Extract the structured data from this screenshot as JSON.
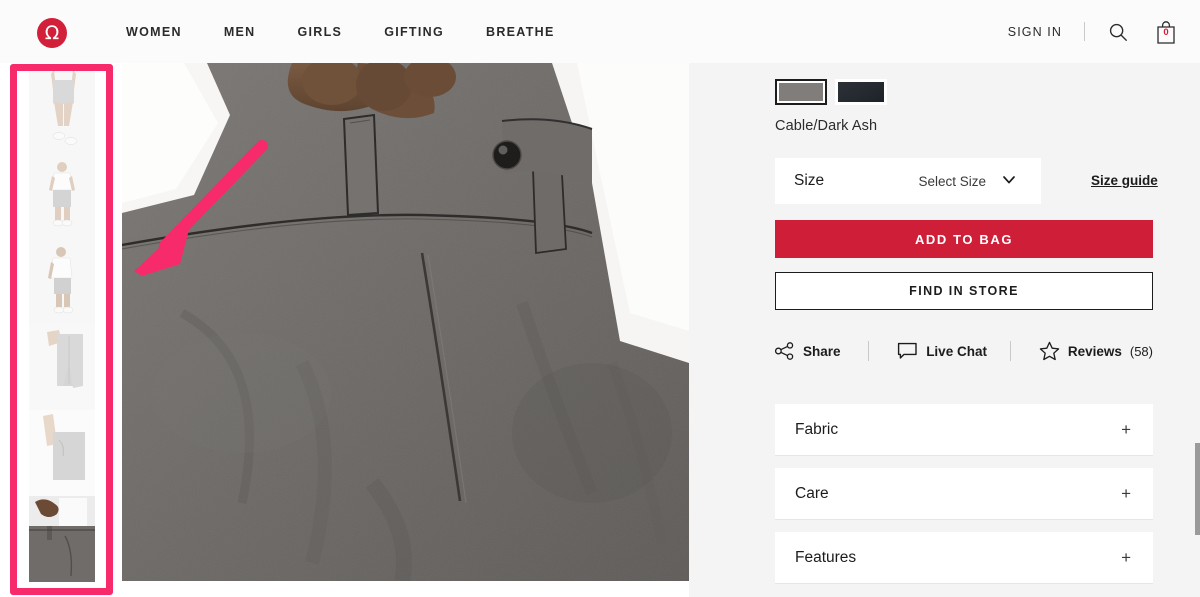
{
  "header": {
    "logo_name": "lululemon-logo",
    "logo_glyph": "Ω",
    "logo_color": "#D3203A",
    "nav": [
      {
        "label": "WOMEN"
      },
      {
        "label": "MEN"
      },
      {
        "label": "GIRLS"
      },
      {
        "label": "GIFTING"
      },
      {
        "label": "BREATHE"
      }
    ],
    "sign_in": "SIGN IN",
    "search_icon": "search-icon",
    "bag_icon": "shopping-bag-icon",
    "bag_count": "0"
  },
  "gallery": {
    "thumbnails": [
      {
        "alt": "model walking in gray shorts, waist down"
      },
      {
        "alt": "model standing front view in white tee and gray shorts"
      },
      {
        "alt": "model back view in white tee and gray shorts"
      },
      {
        "alt": "close up of gray shorts side"
      },
      {
        "alt": "close up of gray shorts pocket"
      },
      {
        "alt": "close up of gray shorts waistband and hand"
      }
    ],
    "selected_index": 5,
    "main_alt": "close up of gray shorts waistband, belt loop and button"
  },
  "annotations": {
    "color": "#F72A6B",
    "box_name": "thumbnail-rail-highlight",
    "arrow_name": "pointer-arrow"
  },
  "product": {
    "colors": [
      {
        "name": "Cable",
        "hex": "#807D7A",
        "selected": true
      },
      {
        "name": "Dark Ash",
        "hex": "#242930",
        "selected": false
      }
    ],
    "color_label": "Cable/Dark Ash",
    "size": {
      "label": "Size",
      "value": "Select Size",
      "chevron": "chevron-down-icon",
      "guide_link": "Size guide"
    },
    "add_to_bag": "ADD TO BAG",
    "add_to_bag_color": "#CE1E38",
    "find_in_store": "FIND IN STORE",
    "utilities": [
      {
        "label": "Share",
        "icon": "share-nodes-icon",
        "count": ""
      },
      {
        "label": "Live Chat",
        "icon": "chat-bubble-icon",
        "count": ""
      },
      {
        "label": "Reviews",
        "icon": "star-icon",
        "count": "(58)"
      }
    ],
    "accordions": [
      {
        "title": "Fabric",
        "expander": "+"
      },
      {
        "title": "Care",
        "expander": "+"
      },
      {
        "title": "Features",
        "expander": "+"
      }
    ]
  }
}
